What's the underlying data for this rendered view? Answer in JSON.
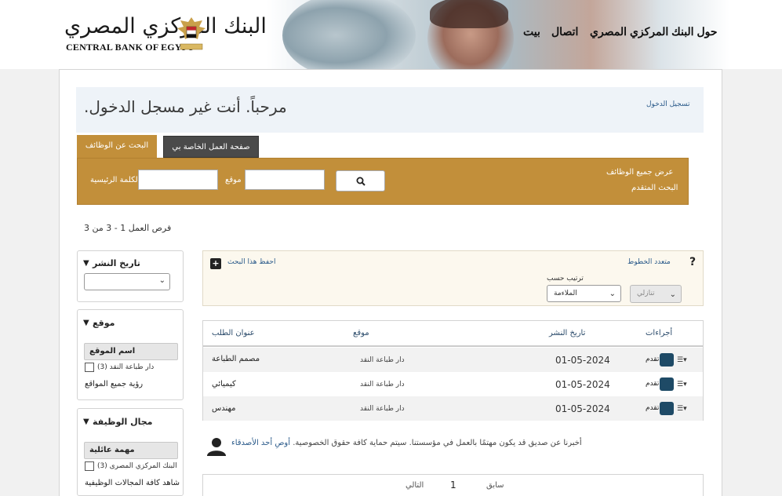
{
  "header": {
    "logo_ar": "البنك المركزي المصري",
    "logo_en": "CENTRAL BANK OF EGYPT",
    "nav": {
      "about": "حول البنك المركزي المصري",
      "contact": "اتصال",
      "home": "بيت"
    }
  },
  "welcome": {
    "text": ".مرحباً. أنت غير مسجل الدخول",
    "login": "تسجيل الدخول"
  },
  "tabs": {
    "search": "البحث عن الوظائف",
    "my_jobs": "صفحة العمل الخاصة بي"
  },
  "search": {
    "keyword_label": "الكلمة الرئيسية",
    "location_label": "موقع",
    "all_jobs": "عرض جميع الوظائف",
    "advanced": "البحث المتقدم"
  },
  "results": {
    "count_text": "فرص العمل 1 - 3 من 3"
  },
  "sidebar": {
    "date": {
      "title": "تاريخ النشر"
    },
    "location": {
      "title": "موقع",
      "header": "اسم الموقع",
      "option": "دار طباعة النقد (3)",
      "see_all": "رؤية جميع المواقع"
    },
    "field": {
      "title": "مجال الوظيفة",
      "header": "مهمة عائلية",
      "option": "البنك المركزي المصرى (3)",
      "see_all": "شاهد كافة المجالات الوظيفية"
    }
  },
  "save_panel": {
    "save_search": "احفظ هذا البحث",
    "multilang": "متعدد الخطوط",
    "help": "?",
    "sort_by": "ترتيب حسب",
    "sort_value": "الملاءمة",
    "order_value": "تنازلي"
  },
  "table": {
    "headers": {
      "title": "عنوان الطلب",
      "location": "موقع",
      "date": "تاريخ النشر",
      "actions": "أجراءات"
    },
    "rows": [
      {
        "title": "مصمم الطباعة",
        "location": "دار طباعة النقد",
        "date": "01-05-2024",
        "apply": "تقدم"
      },
      {
        "title": "كيميائي",
        "location": "دار طباعة النقد",
        "date": "01-05-2024",
        "apply": "تقدم"
      },
      {
        "title": "مهندس",
        "location": "دار طباعة النقد",
        "date": "01-05-2024",
        "apply": "تقدم"
      }
    ]
  },
  "refer": {
    "text": "أخبرنا عن صديق قد يكون مهتمًا بالعمل في مؤسستنا. سيتم حماية كافة حقوق الخصوصية.",
    "link": "أوصِ أحد الأصدقاء"
  },
  "pager": {
    "prev": "سابق",
    "page": "1",
    "next": "التالي"
  },
  "colors": {
    "accent_gold": "#c28f3a",
    "dark_tab": "#4a4a4a",
    "apply_button": "#1e4a66",
    "link": "#2a5a8a"
  }
}
